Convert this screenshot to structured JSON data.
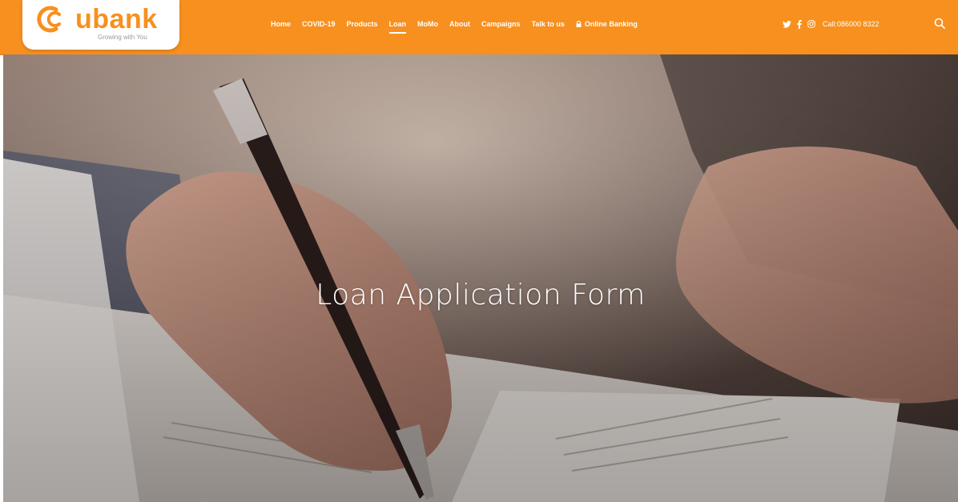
{
  "brand": {
    "name": "ubank",
    "tagline": "Growing with You",
    "accent": "#f7901e"
  },
  "nav": {
    "items": [
      {
        "label": "Home"
      },
      {
        "label": "COVID-19"
      },
      {
        "label": "Products"
      },
      {
        "label": "Loan",
        "active": true
      },
      {
        "label": "MoMo"
      },
      {
        "label": "About"
      },
      {
        "label": "Campaigns"
      },
      {
        "label": "Talk to us"
      },
      {
        "label": "Online Banking",
        "icon": "lock-icon"
      }
    ]
  },
  "social": {
    "icons": [
      "twitter-icon",
      "facebook-icon",
      "instagram-icon"
    ],
    "call_label": "Call:086000 8322"
  },
  "search": {
    "icon": "search-icon"
  },
  "hero": {
    "title": "Loan Application Form",
    "image": "person-signing-document-photo"
  }
}
